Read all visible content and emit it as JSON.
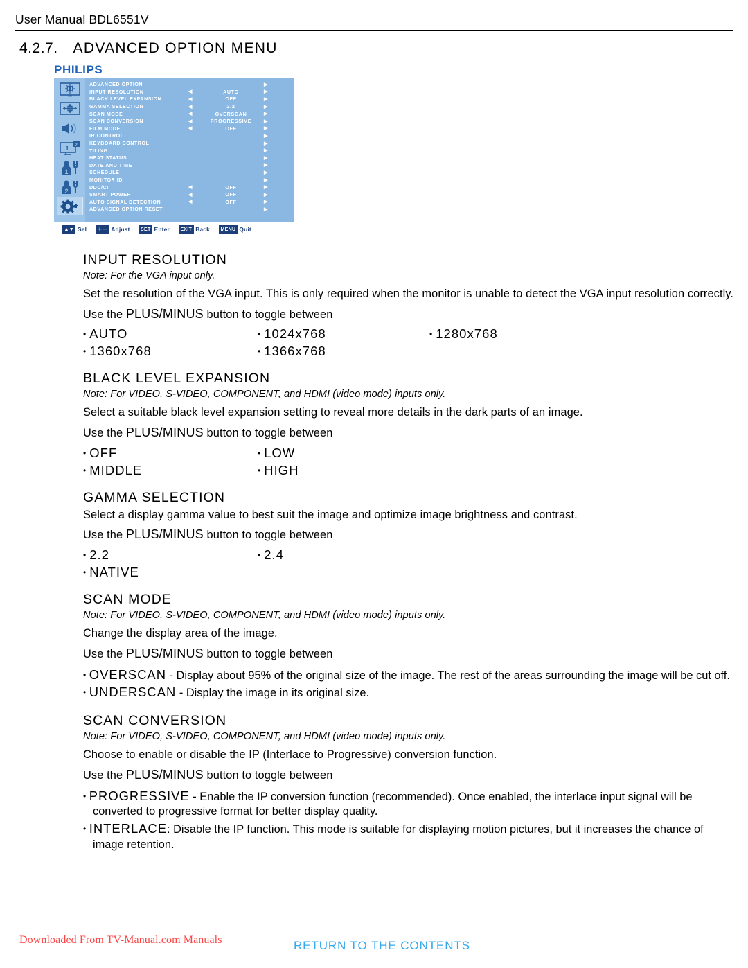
{
  "header": {
    "title": "User Manual BDL6551V"
  },
  "chapter": {
    "number": "4.2.7.",
    "title": "ADVANCED OPTION MENU"
  },
  "osd": {
    "brand": "PHILIPS",
    "sidebar_icons": [
      {
        "name": "picture-icon",
        "label": "PICTURE"
      },
      {
        "name": "screen-position-icon",
        "label": "SCREEN"
      },
      {
        "name": "audio-icon",
        "label": "AUDIO"
      },
      {
        "name": "pip-icon",
        "label": "PIP"
      },
      {
        "name": "configuration1-icon",
        "label": "CONFIGURATION 1"
      },
      {
        "name": "configuration2-icon",
        "label": "CONFIGURATION 2"
      },
      {
        "name": "advanced-option-icon",
        "label": "ADVANCED OPTION"
      }
    ],
    "selected_icon_index": 6,
    "rows": [
      {
        "label": "ADVANCED OPTION",
        "left": "",
        "value": "",
        "right": "▶"
      },
      {
        "label": "INPUT RESOLUTION",
        "left": "◀",
        "value": "AUTO",
        "right": "▶"
      },
      {
        "label": "BLACK LEVEL EXPANSION",
        "left": "◀",
        "value": "OFF",
        "right": "▶"
      },
      {
        "label": "GAMMA SELECTION",
        "left": "◀",
        "value": "2.2",
        "right": "▶"
      },
      {
        "label": "SCAN MODE",
        "left": "◀",
        "value": "OVERSCAN",
        "right": "▶"
      },
      {
        "label": "SCAN CONVERSION",
        "left": "◀",
        "value": "PROGRESSIVE",
        "right": "▶"
      },
      {
        "label": "FILM MODE",
        "left": "◀",
        "value": "OFF",
        "right": "▶"
      },
      {
        "label": "IR CONTROL",
        "left": "",
        "value": "",
        "right": "▶"
      },
      {
        "label": "KEYBOARD CONTROL",
        "left": "",
        "value": "",
        "right": "▶"
      },
      {
        "label": "TILING",
        "left": "",
        "value": "",
        "right": "▶"
      },
      {
        "label": "HEAT STATUS",
        "left": "",
        "value": "",
        "right": "▶"
      },
      {
        "label": "DATE AND TIME",
        "left": "",
        "value": "",
        "right": "▶"
      },
      {
        "label": "SCHEDULE",
        "left": "",
        "value": "",
        "right": "▶"
      },
      {
        "label": "MONITOR ID",
        "left": "",
        "value": "",
        "right": "▶"
      },
      {
        "label": "DDC/CI",
        "left": "◀",
        "value": "OFF",
        "right": "▶"
      },
      {
        "label": "SMART POWER",
        "left": "◀",
        "value": "OFF",
        "right": "▶"
      },
      {
        "label": "AUTO SIGNAL DETECTION",
        "left": "◀",
        "value": "OFF",
        "right": "▶"
      },
      {
        "label": "ADVANCED OPTION RESET",
        "left": "",
        "value": "",
        "right": "▶"
      }
    ],
    "controls": [
      {
        "key": "▲▼",
        "text": "Sel"
      },
      {
        "key": "＋－",
        "text": "Adjust"
      },
      {
        "key": "SET",
        "text": "Enter"
      },
      {
        "key": "EXIT",
        "text": "Back"
      },
      {
        "key": "MENU",
        "text": "Quit"
      }
    ],
    "colors": {
      "panel_bg": "#8ab8e3",
      "sidebar_bg": "#9cc3e8",
      "text": "#ffffff",
      "key_bg": "#1c3f7a",
      "brand": "#1f62b8"
    }
  },
  "sections": {
    "input_resolution": {
      "title": "INPUT RESOLUTION",
      "note": "Note: For the VGA input only.",
      "body": "Set the resolution of the VGA input. This is only required when the monitor is unable to detect the VGA input resolution correctly.",
      "use_prefix": "Use the ",
      "use_strong": "PLUS/MINUS",
      "use_suffix": " button to toggle between",
      "options": [
        "AUTO",
        "1024x768",
        "1280x768",
        "1360x768",
        "1366x768"
      ]
    },
    "black_level_expansion": {
      "title": "BLACK LEVEL EXPANSION",
      "note": "Note: For VIDEO, S-VIDEO, COMPONENT, and HDMI (video mode) inputs only.",
      "body": "Select a suitable black level expansion setting to reveal more details in the dark parts of an image.",
      "use_prefix": "Use the ",
      "use_strong": "PLUS/MINUS",
      "use_suffix": " button to toggle between",
      "options": [
        "OFF",
        "LOW",
        "MIDDLE",
        "HIGH"
      ]
    },
    "gamma_selection": {
      "title": "GAMMA SELECTION",
      "body": "Select a display gamma value to best suit the image and optimize image brightness and contrast.",
      "use_prefix": "Use the ",
      "use_strong": "PLUS/MINUS",
      "use_suffix": " button to toggle between",
      "options": [
        "2.2",
        "2.4",
        "NATIVE"
      ]
    },
    "scan_mode": {
      "title": "SCAN MODE",
      "note": "Note: For VIDEO, S-VIDEO, COMPONENT, and HDMI (video mode) inputs only.",
      "body": "Change the display area of the image.",
      "use_prefix": "Use the ",
      "use_strong": "PLUS/MINUS",
      "use_suffix": " button to toggle between",
      "bullets": [
        {
          "keyword": "OVERSCAN",
          "text": " - Display about 95% of the original size of the image. The rest of the areas surrounding the image will be cut off."
        },
        {
          "keyword": "UNDERSCAN",
          "text": " - Display the image in its original size."
        }
      ]
    },
    "scan_conversion": {
      "title": "SCAN CONVERSION",
      "note": "Note: For VIDEO, S-VIDEO, COMPONENT, and HDMI (video mode) inputs only.",
      "body": "Choose to enable or disable the IP (Interlace to Progressive) conversion function.",
      "use_prefix": "Use the ",
      "use_strong": "PLUS/MINUS",
      "use_suffix": " button to toggle between",
      "bullets": [
        {
          "keyword": "PROGRESSIVE",
          "text": " - Enable the IP conversion function (recommended). Once enabled, the interlace input signal will be converted to progressive format for better display quality."
        },
        {
          "keyword": "INTERLACE",
          "text": ": Disable the IP function. This mode is suitable for displaying motion pictures, but it increases the chance of image retention."
        }
      ]
    }
  },
  "footer": {
    "downloaded": "Downloaded From TV-Manual.com Manuals",
    "return_link": "RETURN TO THE CONTENTS",
    "downloaded_color": "#ff4444",
    "return_color": "#33a8ee"
  }
}
